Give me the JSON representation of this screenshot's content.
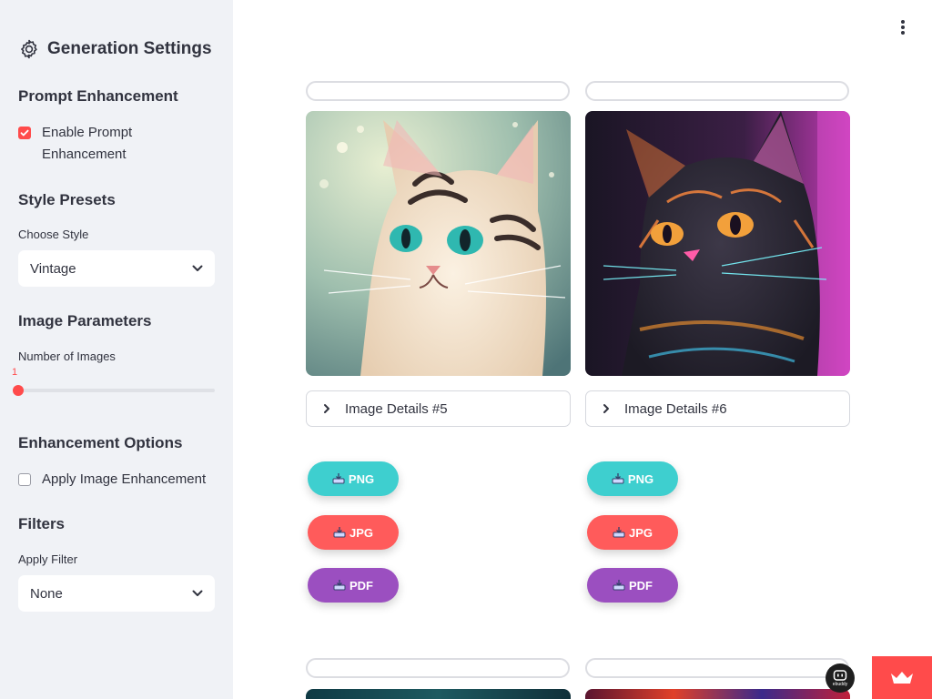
{
  "sidebar": {
    "title": "Generation Settings",
    "prompt_section": "Prompt Enhancement",
    "enable_prompt_label": "Enable Prompt Enhancement",
    "enable_prompt_checked": true,
    "style_section": "Style Presets",
    "choose_style_label": "Choose Style",
    "style_value": "Vintage",
    "image_params_section": "Image Parameters",
    "num_images_label": "Number of Images",
    "num_images_value": "1",
    "enhancement_section": "Enhancement Options",
    "apply_enhancement_label": "Apply Image Enhancement",
    "apply_enhancement_checked": false,
    "filters_section": "Filters",
    "apply_filter_label": "Apply Filter",
    "filter_value": "None"
  },
  "main": {
    "cards": [
      {
        "details_label": "Image Details #5",
        "buttons": [
          {
            "label": "PNG",
            "color": "#3ecfcf"
          },
          {
            "label": "JPG",
            "color": "#ff5b5b"
          },
          {
            "label": "PDF",
            "color": "#9b4fc0"
          }
        ]
      },
      {
        "details_label": "Image Details #6",
        "buttons": [
          {
            "label": "PNG",
            "color": "#3ecfcf"
          },
          {
            "label": "JPG",
            "color": "#ff5b5b"
          },
          {
            "label": "PDF",
            "color": "#9b4fc0"
          }
        ]
      }
    ]
  },
  "badge": {
    "text": "ebuddy"
  },
  "colors": {
    "accent": "#ff4b4b",
    "sidebar_bg": "#f0f2f6"
  }
}
